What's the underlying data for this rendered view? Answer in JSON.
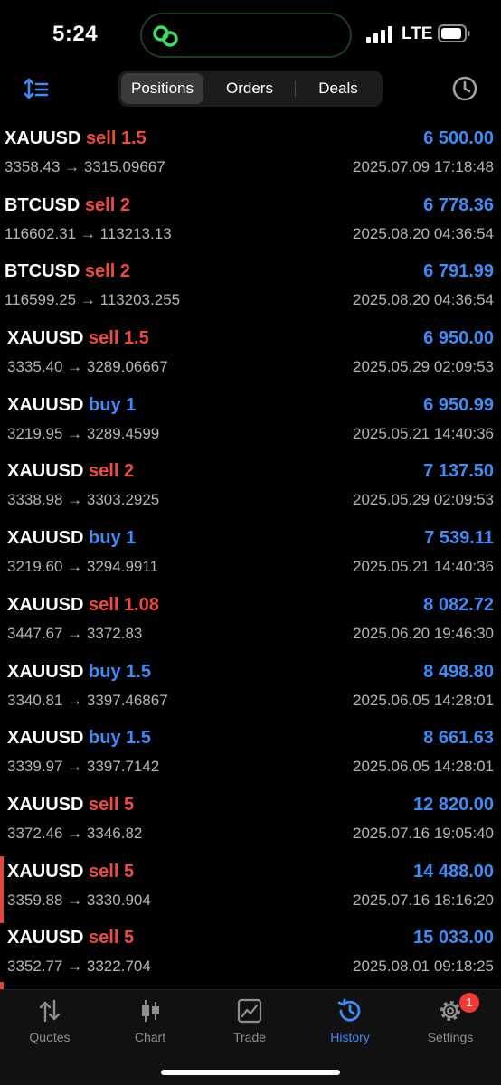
{
  "status_bar": {
    "time": "5:24",
    "network": "LTE"
  },
  "tabs_top": {
    "positions": "Positions",
    "orders": "Orders",
    "deals": "Deals"
  },
  "trades": [
    {
      "symbol": "XAUUSD",
      "side": "sell",
      "volume": "1.5",
      "prices": "3358.43 → 3315.09667",
      "profit": "6 500.00",
      "date": "2025.07.09 17:18:48"
    },
    {
      "symbol": "BTCUSD",
      "side": "sell",
      "volume": "2",
      "prices": "116602.31 → 113213.13",
      "profit": "6 778.36",
      "date": "2025.08.20 04:36:54"
    },
    {
      "symbol": "BTCUSD",
      "side": "sell",
      "volume": "2",
      "prices": "116599.25 → 113203.255",
      "profit": "6 791.99",
      "date": "2025.08.20 04:36:54"
    },
    {
      "symbol": "XAUUSD",
      "side": "sell",
      "volume": "1.5",
      "prices": "3335.40 → 3289.06667",
      "profit": "6 950.00",
      "date": "2025.05.29 02:09:53"
    },
    {
      "symbol": "XAUUSD",
      "side": "buy",
      "volume": "1",
      "prices": "3219.95 → 3289.4599",
      "profit": "6 950.99",
      "date": "2025.05.21 14:40:36"
    },
    {
      "symbol": "XAUUSD",
      "side": "sell",
      "volume": "2",
      "prices": "3338.98 → 3303.2925",
      "profit": "7 137.50",
      "date": "2025.05.29 02:09:53"
    },
    {
      "symbol": "XAUUSD",
      "side": "buy",
      "volume": "1",
      "prices": "3219.60 → 3294.9911",
      "profit": "7 539.11",
      "date": "2025.05.21 14:40:36"
    },
    {
      "symbol": "XAUUSD",
      "side": "sell",
      "volume": "1.08",
      "prices": "3447.67 → 3372.83",
      "profit": "8 082.72",
      "date": "2025.06.20 19:46:30"
    },
    {
      "symbol": "XAUUSD",
      "side": "buy",
      "volume": "1.5",
      "prices": "3340.81 → 3397.46867",
      "profit": "8 498.80",
      "date": "2025.06.05 14:28:01"
    },
    {
      "symbol": "XAUUSD",
      "side": "buy",
      "volume": "1.5",
      "prices": "3339.97 → 3397.7142",
      "profit": "8 661.63",
      "date": "2025.06.05 14:28:01"
    },
    {
      "symbol": "XAUUSD",
      "side": "sell",
      "volume": "5",
      "prices": "3372.46 → 3346.82",
      "profit": "12 820.00",
      "date": "2025.07.16 19:05:40"
    },
    {
      "symbol": "XAUUSD",
      "side": "sell",
      "volume": "5",
      "prices": "3359.88 → 3330.904",
      "profit": "14 488.00",
      "date": "2025.07.16 18:16:20"
    },
    {
      "symbol": "XAUUSD",
      "side": "sell",
      "volume": "5",
      "prices": "3352.77 → 3322.704",
      "profit": "15 033.00",
      "date": "2025.08.01 09:18:25"
    }
  ],
  "tabbar": {
    "quotes": "Quotes",
    "chart": "Chart",
    "trade": "Trade",
    "history": "History",
    "settings": "Settings",
    "settings_badge": "1"
  },
  "colors": {
    "sell": "#ef4a3e",
    "buy": "#3e8df7",
    "profit": "#3e8df7",
    "active_tab": "#3e8df7"
  }
}
